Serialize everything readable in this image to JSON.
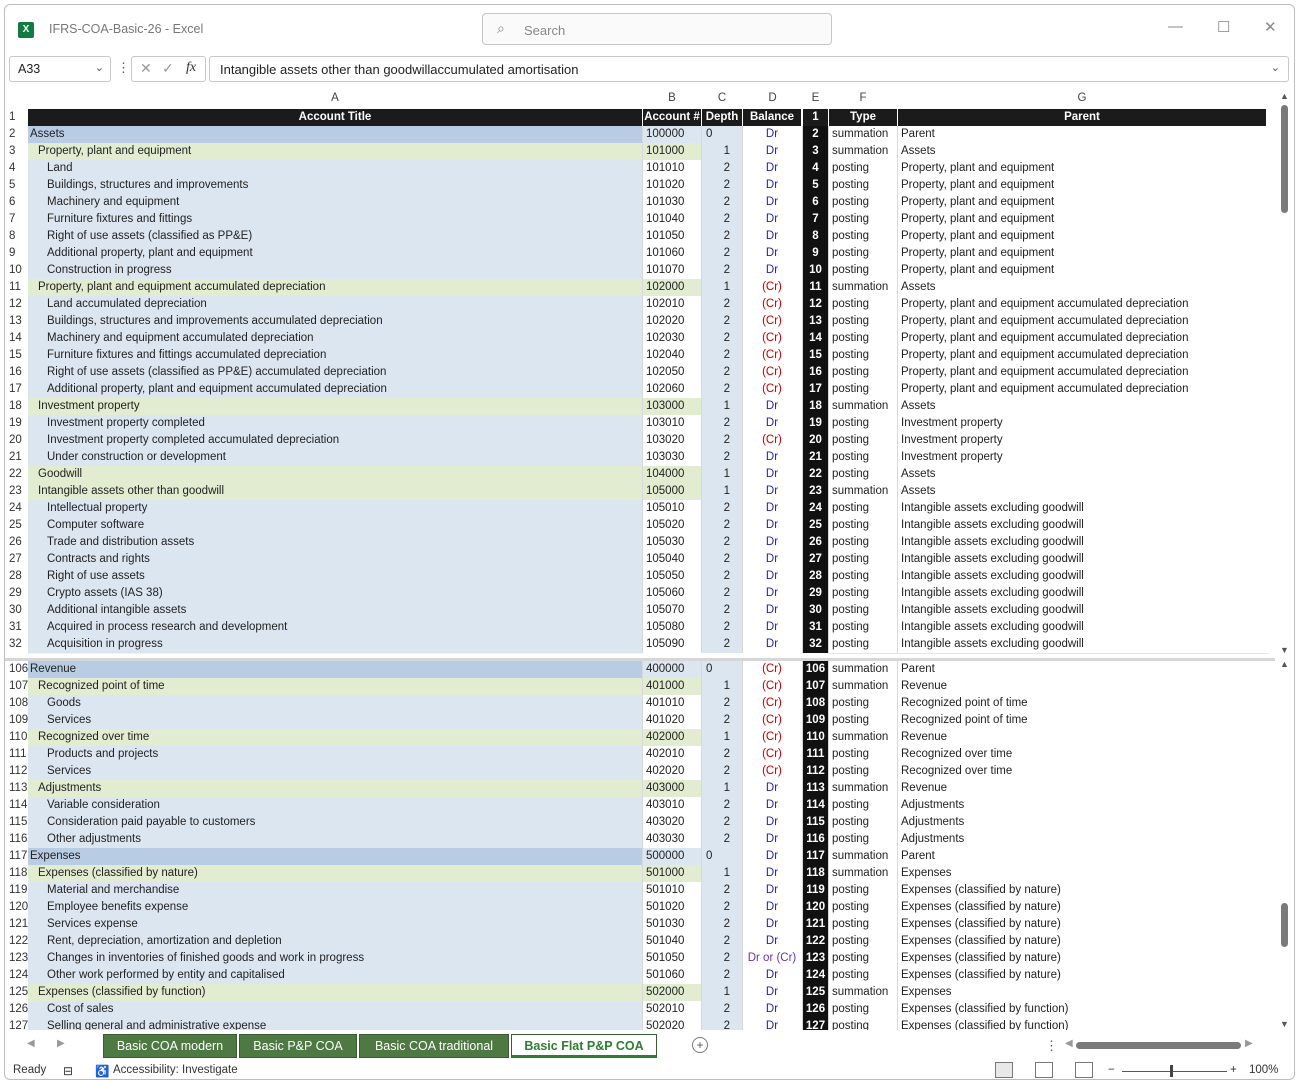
{
  "app": {
    "title": "IFRS-COA-Basic-26",
    "separator": "-",
    "app_name": "Excel",
    "search_placeholder": "Search",
    "logo_letter": "X"
  },
  "formula_bar": {
    "name_box": "A33",
    "formula": "Intangible assets other than goodwillaccumulated amortisation"
  },
  "columns": [
    {
      "letter": "A"
    },
    {
      "letter": "B"
    },
    {
      "letter": "C"
    },
    {
      "letter": "D"
    },
    {
      "letter": "E"
    },
    {
      "letter": "F"
    },
    {
      "letter": "G"
    }
  ],
  "header_row": {
    "num": "1",
    "A": "Account Title",
    "B": "Account #",
    "C": "Depth",
    "D": "Balance",
    "E": "1",
    "F": "Type",
    "G": "Parent"
  },
  "top_rows": [
    {
      "num": "2",
      "lvl": 0,
      "title": "Assets",
      "acct": "100000",
      "depth": "0",
      "bal": "Dr",
      "e": "2",
      "type": "summation",
      "parent": "Parent"
    },
    {
      "num": "3",
      "lvl": 1,
      "title": "Property, plant and equipment",
      "acct": "101000",
      "depth": "1",
      "bal": "Dr",
      "e": "3",
      "type": "summation",
      "parent": "Assets"
    },
    {
      "num": "4",
      "lvl": 2,
      "title": "Land",
      "acct": "101010",
      "depth": "2",
      "bal": "Dr",
      "e": "4",
      "type": "posting",
      "parent": "Property, plant and equipment"
    },
    {
      "num": "5",
      "lvl": 2,
      "title": "Buildings, structures and improvements",
      "acct": "101020",
      "depth": "2",
      "bal": "Dr",
      "e": "5",
      "type": "posting",
      "parent": "Property, plant and equipment"
    },
    {
      "num": "6",
      "lvl": 2,
      "title": "Machinery and equipment",
      "acct": "101030",
      "depth": "2",
      "bal": "Dr",
      "e": "6",
      "type": "posting",
      "parent": "Property, plant and equipment"
    },
    {
      "num": "7",
      "lvl": 2,
      "title": "Furniture fixtures and fittings",
      "acct": "101040",
      "depth": "2",
      "bal": "Dr",
      "e": "7",
      "type": "posting",
      "parent": "Property, plant and equipment"
    },
    {
      "num": "8",
      "lvl": 2,
      "title": "Right of use assets (classified as PP&E)",
      "acct": "101050",
      "depth": "2",
      "bal": "Dr",
      "e": "8",
      "type": "posting",
      "parent": "Property, plant and equipment"
    },
    {
      "num": "9",
      "lvl": 2,
      "title": "Additional property, plant and equipment",
      "acct": "101060",
      "depth": "2",
      "bal": "Dr",
      "e": "9",
      "type": "posting",
      "parent": "Property, plant and equipment"
    },
    {
      "num": "10",
      "lvl": 2,
      "title": "Construction in progress",
      "acct": "101070",
      "depth": "2",
      "bal": "Dr",
      "e": "10",
      "type": "posting",
      "parent": "Property, plant and equipment"
    },
    {
      "num": "11",
      "lvl": 1,
      "title": "Property, plant and equipment accumulated depreciation",
      "acct": "102000",
      "depth": "1",
      "bal": "(Cr)",
      "e": "11",
      "type": "summation",
      "parent": "Assets"
    },
    {
      "num": "12",
      "lvl": 2,
      "title": "Land accumulated depreciation",
      "acct": "102010",
      "depth": "2",
      "bal": "(Cr)",
      "e": "12",
      "type": "posting",
      "parent": "Property, plant and equipment accumulated depreciation"
    },
    {
      "num": "13",
      "lvl": 2,
      "title": "Buildings, structures and improvements accumulated depreciation",
      "acct": "102020",
      "depth": "2",
      "bal": "(Cr)",
      "e": "13",
      "type": "posting",
      "parent": "Property, plant and equipment accumulated depreciation"
    },
    {
      "num": "14",
      "lvl": 2,
      "title": "Machinery and equipment accumulated depreciation",
      "acct": "102030",
      "depth": "2",
      "bal": "(Cr)",
      "e": "14",
      "type": "posting",
      "parent": "Property, plant and equipment accumulated depreciation"
    },
    {
      "num": "15",
      "lvl": 2,
      "title": "Furniture fixtures and fittings accumulated depreciation",
      "acct": "102040",
      "depth": "2",
      "bal": "(Cr)",
      "e": "15",
      "type": "posting",
      "parent": "Property, plant and equipment accumulated depreciation"
    },
    {
      "num": "16",
      "lvl": 2,
      "title": "Right of use assets (classified as PP&E) accumulated depreciation",
      "acct": "102050",
      "depth": "2",
      "bal": "(Cr)",
      "e": "16",
      "type": "posting",
      "parent": "Property, plant and equipment accumulated depreciation"
    },
    {
      "num": "17",
      "lvl": 2,
      "title": "Additional property, plant and equipment accumulated depreciation",
      "acct": "102060",
      "depth": "2",
      "bal": "(Cr)",
      "e": "17",
      "type": "posting",
      "parent": "Property, plant and equipment accumulated depreciation"
    },
    {
      "num": "18",
      "lvl": 1,
      "title": "Investment property",
      "acct": "103000",
      "depth": "1",
      "bal": "Dr",
      "e": "18",
      "type": "summation",
      "parent": "Assets"
    },
    {
      "num": "19",
      "lvl": 2,
      "title": "Investment property completed",
      "acct": "103010",
      "depth": "2",
      "bal": "Dr",
      "e": "19",
      "type": "posting",
      "parent": "Investment property"
    },
    {
      "num": "20",
      "lvl": 2,
      "title": "Investment property completed accumulated depreciation",
      "acct": "103020",
      "depth": "2",
      "bal": "(Cr)",
      "e": "20",
      "type": "posting",
      "parent": "Investment property"
    },
    {
      "num": "21",
      "lvl": 2,
      "title": "Under construction or development",
      "acct": "103030",
      "depth": "2",
      "bal": "Dr",
      "e": "21",
      "type": "posting",
      "parent": "Investment property"
    },
    {
      "num": "22",
      "lvl": 1,
      "title": "Goodwill",
      "acct": "104000",
      "depth": "1",
      "bal": "Dr",
      "e": "22",
      "type": "posting",
      "parent": "Assets"
    },
    {
      "num": "23",
      "lvl": 1,
      "title": "Intangible assets other than goodwill",
      "acct": "105000",
      "depth": "1",
      "bal": "Dr",
      "e": "23",
      "type": "summation",
      "parent": "Assets"
    },
    {
      "num": "24",
      "lvl": 2,
      "title": "Intellectual property",
      "acct": "105010",
      "depth": "2",
      "bal": "Dr",
      "e": "24",
      "type": "posting",
      "parent": "Intangible assets excluding goodwill"
    },
    {
      "num": "25",
      "lvl": 2,
      "title": "Computer software",
      "acct": "105020",
      "depth": "2",
      "bal": "Dr",
      "e": "25",
      "type": "posting",
      "parent": "Intangible assets excluding goodwill"
    },
    {
      "num": "26",
      "lvl": 2,
      "title": "Trade and distribution assets",
      "acct": "105030",
      "depth": "2",
      "bal": "Dr",
      "e": "26",
      "type": "posting",
      "parent": "Intangible assets excluding goodwill"
    },
    {
      "num": "27",
      "lvl": 2,
      "title": "Contracts and rights",
      "acct": "105040",
      "depth": "2",
      "bal": "Dr",
      "e": "27",
      "type": "posting",
      "parent": "Intangible assets excluding goodwill"
    },
    {
      "num": "28",
      "lvl": 2,
      "title": "Right of use assets",
      "acct": "105050",
      "depth": "2",
      "bal": "Dr",
      "e": "28",
      "type": "posting",
      "parent": "Intangible assets excluding goodwill"
    },
    {
      "num": "29",
      "lvl": 2,
      "title": "Crypto assets (IAS 38)",
      "acct": "105060",
      "depth": "2",
      "bal": "Dr",
      "e": "29",
      "type": "posting",
      "parent": "Intangible assets excluding goodwill"
    },
    {
      "num": "30",
      "lvl": 2,
      "title": "Additional intangible assets",
      "acct": "105070",
      "depth": "2",
      "bal": "Dr",
      "e": "30",
      "type": "posting",
      "parent": "Intangible assets excluding goodwill"
    },
    {
      "num": "31",
      "lvl": 2,
      "title": "Acquired in process research and development",
      "acct": "105080",
      "depth": "2",
      "bal": "Dr",
      "e": "31",
      "type": "posting",
      "parent": "Intangible assets excluding goodwill"
    },
    {
      "num": "32",
      "lvl": 2,
      "title": "Acquisition in progress",
      "acct": "105090",
      "depth": "2",
      "bal": "Dr",
      "e": "32",
      "type": "posting",
      "parent": "Intangible assets excluding goodwill"
    }
  ],
  "bottom_rows": [
    {
      "num": "106",
      "lvl": 0,
      "title": "Revenue",
      "acct": "400000",
      "depth": "0",
      "bal": "(Cr)",
      "e": "106",
      "type": "summation",
      "parent": "Parent"
    },
    {
      "num": "107",
      "lvl": 1,
      "title": "Recognized point of time",
      "acct": "401000",
      "depth": "1",
      "bal": "(Cr)",
      "e": "107",
      "type": "summation",
      "parent": "Revenue"
    },
    {
      "num": "108",
      "lvl": 2,
      "title": "Goods",
      "acct": "401010",
      "depth": "2",
      "bal": "(Cr)",
      "e": "108",
      "type": "posting",
      "parent": "Recognized point of time"
    },
    {
      "num": "109",
      "lvl": 2,
      "title": "Services",
      "acct": "401020",
      "depth": "2",
      "bal": "(Cr)",
      "e": "109",
      "type": "posting",
      "parent": "Recognized point of time"
    },
    {
      "num": "110",
      "lvl": 1,
      "title": "Recognized over time",
      "acct": "402000",
      "depth": "1",
      "bal": "(Cr)",
      "e": "110",
      "type": "summation",
      "parent": "Revenue"
    },
    {
      "num": "111",
      "lvl": 2,
      "title": "Products and projects",
      "acct": "402010",
      "depth": "2",
      "bal": "(Cr)",
      "e": "111",
      "type": "posting",
      "parent": "Recognized over time"
    },
    {
      "num": "112",
      "lvl": 2,
      "title": "Services",
      "acct": "402020",
      "depth": "2",
      "bal": "(Cr)",
      "e": "112",
      "type": "posting",
      "parent": "Recognized over time"
    },
    {
      "num": "113",
      "lvl": 1,
      "title": "Adjustments",
      "acct": "403000",
      "depth": "1",
      "bal": "Dr",
      "e": "113",
      "type": "summation",
      "parent": "Revenue"
    },
    {
      "num": "114",
      "lvl": 2,
      "title": "Variable consideration",
      "acct": "403010",
      "depth": "2",
      "bal": "Dr",
      "e": "114",
      "type": "posting",
      "parent": "Adjustments"
    },
    {
      "num": "115",
      "lvl": 2,
      "title": "Consideration paid payable to customers",
      "acct": "403020",
      "depth": "2",
      "bal": "Dr",
      "e": "115",
      "type": "posting",
      "parent": "Adjustments"
    },
    {
      "num": "116",
      "lvl": 2,
      "title": "Other adjustments",
      "acct": "403030",
      "depth": "2",
      "bal": "Dr",
      "e": "116",
      "type": "posting",
      "parent": "Adjustments"
    },
    {
      "num": "117",
      "lvl": 0,
      "title": "Expenses",
      "acct": "500000",
      "depth": "0",
      "bal": "Dr",
      "e": "117",
      "type": "summation",
      "parent": "Parent"
    },
    {
      "num": "118",
      "lvl": 1,
      "title": "Expenses (classified by nature)",
      "acct": "501000",
      "depth": "1",
      "bal": "Dr",
      "e": "118",
      "type": "summation",
      "parent": "Expenses"
    },
    {
      "num": "119",
      "lvl": 2,
      "title": "Material and merchandise",
      "acct": "501010",
      "depth": "2",
      "bal": "Dr",
      "e": "119",
      "type": "posting",
      "parent": "Expenses (classified by nature)"
    },
    {
      "num": "120",
      "lvl": 2,
      "title": "Employee benefits expense",
      "acct": "501020",
      "depth": "2",
      "bal": "Dr",
      "e": "120",
      "type": "posting",
      "parent": "Expenses (classified by nature)"
    },
    {
      "num": "121",
      "lvl": 2,
      "title": "Services expense",
      "acct": "501030",
      "depth": "2",
      "bal": "Dr",
      "e": "121",
      "type": "posting",
      "parent": "Expenses (classified by nature)"
    },
    {
      "num": "122",
      "lvl": 2,
      "title": "Rent, depreciation, amortization and depletion",
      "acct": "501040",
      "depth": "2",
      "bal": "Dr",
      "e": "122",
      "type": "posting",
      "parent": "Expenses (classified by nature)"
    },
    {
      "num": "123",
      "lvl": 2,
      "title": "Changes in inventories of finished goods and work in progress",
      "acct": "501050",
      "depth": "2",
      "bal": "Dr or (Cr)",
      "e": "123",
      "type": "posting",
      "parent": "Expenses (classified by nature)"
    },
    {
      "num": "124",
      "lvl": 2,
      "title": "Other work performed by entity and capitalised",
      "acct": "501060",
      "depth": "2",
      "bal": "Dr",
      "e": "124",
      "type": "posting",
      "parent": "Expenses (classified by nature)"
    },
    {
      "num": "125",
      "lvl": 1,
      "title": "Expenses (classified by function)",
      "acct": "502000",
      "depth": "1",
      "bal": "Dr",
      "e": "125",
      "type": "summation",
      "parent": "Expenses"
    },
    {
      "num": "126",
      "lvl": 2,
      "title": "Cost of sales",
      "acct": "502010",
      "depth": "2",
      "bal": "Dr",
      "e": "126",
      "type": "posting",
      "parent": "Expenses (classified by function)"
    },
    {
      "num": "127",
      "lvl": 2,
      "title": "Selling general and administrative expense",
      "acct": "502020",
      "depth": "2",
      "bal": "Dr",
      "e": "127",
      "type": "posting",
      "parent": "Expenses (classified by function)"
    }
  ],
  "tabs": [
    {
      "label": "Basic COA modern",
      "active": false
    },
    {
      "label": "Basic P&P COA",
      "active": false
    },
    {
      "label": "Basic COA traditional",
      "active": false
    },
    {
      "label": "Basic Flat P&P COA",
      "active": true
    }
  ],
  "status": {
    "ready": "Ready",
    "accessibility": "Accessibility: Investigate",
    "zoom": "100%"
  },
  "icons": {
    "add_sheet": "plus-circle-icon",
    "search": "search-icon",
    "fx": "fx-icon"
  }
}
